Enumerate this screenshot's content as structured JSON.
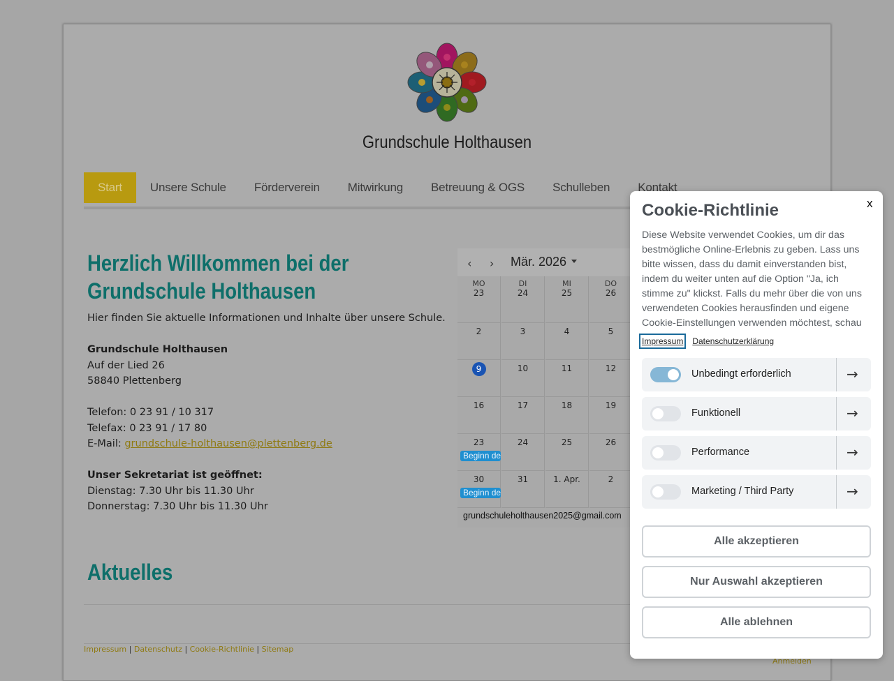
{
  "site": {
    "title": "Grundschule Holthausen",
    "logo_icon": "flower-logo-icon"
  },
  "nav": {
    "items": [
      {
        "label": "Start",
        "active": true
      },
      {
        "label": "Unsere Schule"
      },
      {
        "label": "Förderverein"
      },
      {
        "label": "Mitwirkung"
      },
      {
        "label": "Betreuung & OGS"
      },
      {
        "label": "Schulleben"
      },
      {
        "label": "Kontakt"
      }
    ]
  },
  "main": {
    "heading_line1": "Herzlich Willkommen bei der",
    "heading_line2": "Grundschule Holthausen",
    "intro": "Hier finden Sie aktuelle Informationen und Inhalte über unsere Schule.",
    "address_name": "Grundschule Holthausen",
    "address_street": "Auf der Lied 26",
    "address_city": "58840 Plettenberg",
    "phone": "Telefon: 0 23 91 / 10 317",
    "fax": "Telefax: 0 23 91 / 17 80",
    "email_label": "E-Mail: ",
    "email": "grundschule-holthausen@plettenberg.de",
    "office_heading": "Unser Sekretariat ist geöffnet:",
    "office_tuesday": "Dienstag: 7.30 Uhr bis 11.30 Uhr",
    "office_thursday": "Donnerstag: 7.30 Uhr bis 11.30 Uhr",
    "news_heading": "Aktuelles"
  },
  "calendar": {
    "month": "Mär. 2026",
    "prev_icon": "chevron-left-icon",
    "next_icon": "chevron-right-icon",
    "weekdays": [
      "MO",
      "DI",
      "MI",
      "DO"
    ],
    "weeks": [
      [
        "23",
        "24",
        "25",
        "26"
      ],
      [
        "2",
        "3",
        "4",
        "5"
      ],
      [
        "9",
        "10",
        "11",
        "12"
      ],
      [
        "16",
        "17",
        "18",
        "19"
      ],
      [
        "23",
        "24",
        "25",
        "26"
      ],
      [
        "30",
        "31",
        "1. Apr.",
        "2"
      ]
    ],
    "today": "9",
    "events": [
      {
        "label": "Beginn de"
      },
      {
        "label": "Beginn de"
      }
    ],
    "account": "grundschuleholthausen2025@gmail.com"
  },
  "footer": {
    "links": [
      "Impressum",
      "Datenschutz",
      "Cookie-Richtlinie",
      "Sitemap"
    ],
    "separator": "|",
    "login": "Anmelden"
  },
  "cookie": {
    "close": "x",
    "title": "Cookie-Richtlinie",
    "body": "Diese Website verwendet Cookies, um dir das bestmögliche Online-Erlebnis zu geben. Lass uns bitte wissen, dass du damit einverstanden bist, indem du weiter unten auf die Option \"Ja, ich stimme zu\" klickst. Falls du mehr über die von uns verwendeten Cookies herausfinden und eigene Cookie-Einstellungen verwenden möchtest, schau",
    "link_impressum": "Impressum",
    "link_privacy": "Datenschutzerklärung",
    "categories": [
      {
        "label": "Unbedingt erforderlich",
        "enabled": true
      },
      {
        "label": "Funktionell",
        "enabled": false
      },
      {
        "label": "Performance",
        "enabled": false
      },
      {
        "label": "Marketing / Third Party",
        "enabled": false
      }
    ],
    "arrow_icon": "arrow-right-icon",
    "accept_all": "Alle akzeptieren",
    "accept_selection": "Nur Auswahl akzeptieren",
    "reject_all": "Alle ablehnen"
  }
}
